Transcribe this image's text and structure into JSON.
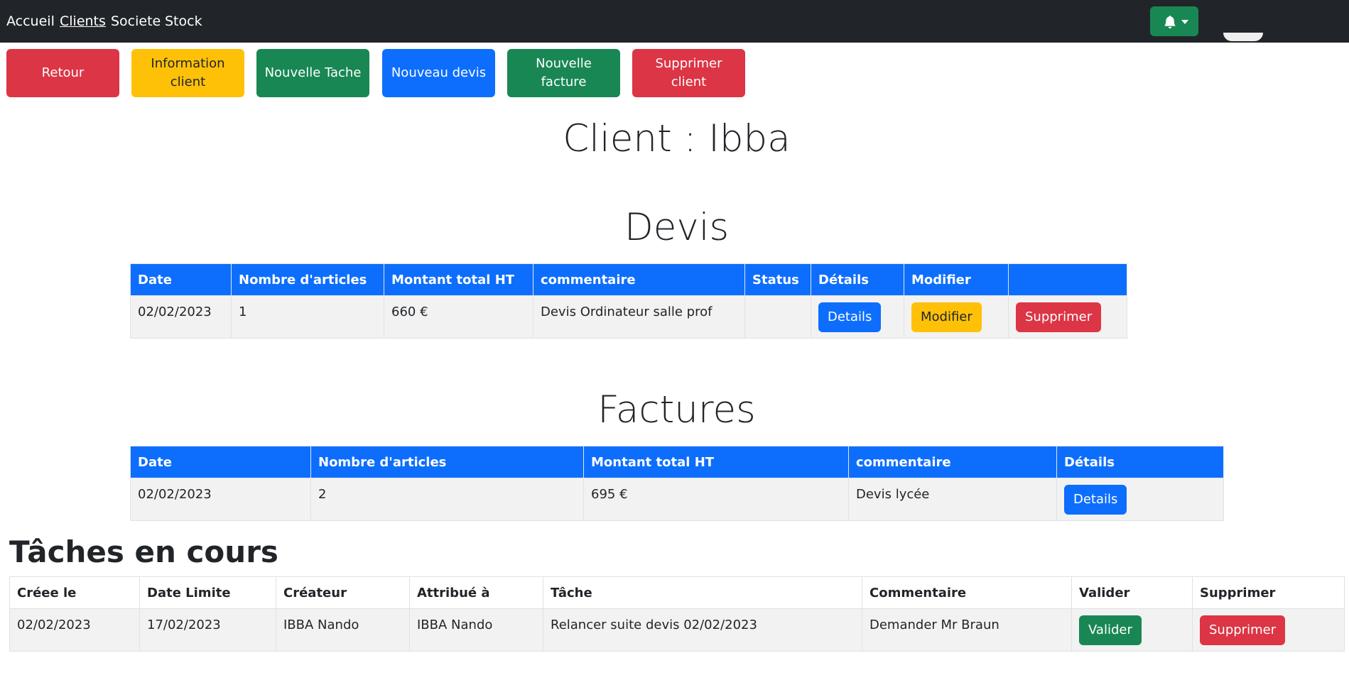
{
  "nav": {
    "items": [
      "Accueil",
      "Clients",
      "Societe",
      "Stock"
    ]
  },
  "actions": {
    "retour": "Retour",
    "info_client": "Information\nclient",
    "nouvelle_tache": "Nouvelle Tache",
    "nouveau_devis": "Nouveau devis",
    "nouvelle_facture": "Nouvelle\nfacture",
    "supprimer_client": "Supprimer\nclient"
  },
  "page_title": "Client : Ibba",
  "devis": {
    "title": "Devis",
    "headers": [
      "Date",
      "Nombre d'articles",
      "Montant total HT",
      "commentaire",
      "Status",
      "Détails",
      "Modifier",
      ""
    ],
    "rows": [
      {
        "date": "02/02/2023",
        "nb": "1",
        "montant": "660 €",
        "commentaire": "Devis Ordinateur salle prof",
        "status": "",
        "details": "Details",
        "modifier": "Modifier",
        "supprimer": "Supprimer"
      }
    ]
  },
  "factures": {
    "title": "Factures",
    "headers": [
      "Date",
      "Nombre d'articles",
      "Montant total HT",
      "commentaire",
      "Détails"
    ],
    "rows": [
      {
        "date": "02/02/2023",
        "nb": "2",
        "montant": "695 €",
        "commentaire": "Devis lycée",
        "details": "Details"
      }
    ]
  },
  "taches": {
    "title": "Tâches en cours",
    "headers": [
      "Créee le",
      "Date Limite",
      "Créateur",
      "Attribué à",
      "Tâche",
      "Commentaire",
      "Valider",
      "Supprimer"
    ],
    "rows": [
      {
        "cree": "02/02/2023",
        "limite": "17/02/2023",
        "createur": "IBBA Nando",
        "attribue": "IBBA Nando",
        "tache": "Relancer suite devis 02/02/2023",
        "commentaire": "Demander Mr Braun",
        "valider": "Valider",
        "supprimer": "Supprimer"
      }
    ]
  },
  "colors": {
    "navbar": "#212529",
    "primary": "#0d6efd",
    "success": "#198754",
    "danger": "#dc3545",
    "warning": "#ffc107"
  }
}
